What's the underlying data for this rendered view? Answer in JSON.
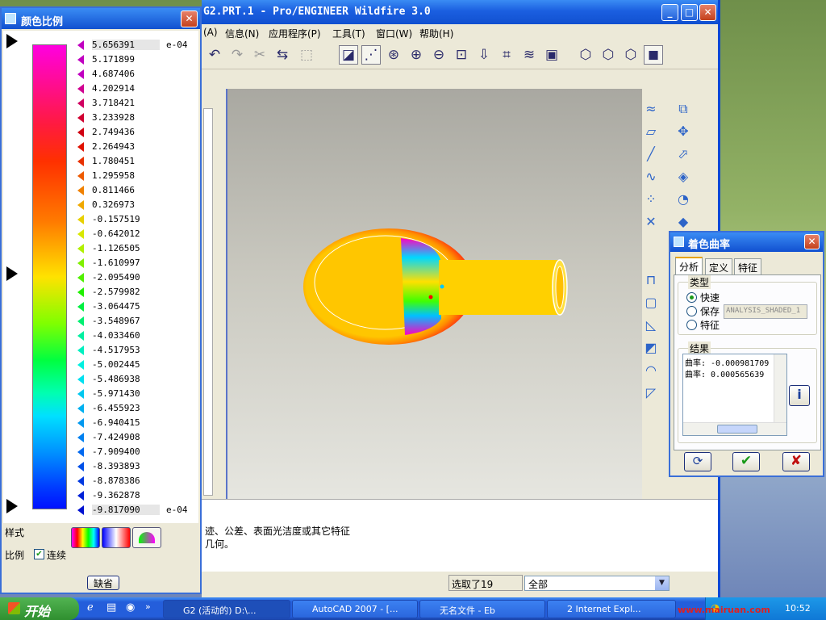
{
  "main_window": {
    "title": "G2.PRT.1 - Pro/ENGINEER Wildfire 3.0",
    "menu": [
      "(A)",
      "信息(N)",
      "应用程序(P)",
      "工具(T)",
      "窗口(W)",
      "帮助(H)"
    ],
    "message_lines": [
      "迹、公差、表面光洁度或其它特征",
      "几何。"
    ],
    "selection_count": "选取了19",
    "filter_value": "全部"
  },
  "scale_panel": {
    "title": "颜色比例",
    "values": [
      "5.656391",
      "5.171899",
      "4.687406",
      "4.202914",
      "3.718421",
      "3.233928",
      "2.749436",
      "2.264943",
      "1.780451",
      "1.295958",
      "0.811466",
      "0.326973",
      "-0.157519",
      "-0.642012",
      "-1.126505",
      "-1.610997",
      "-2.095490",
      "-2.579982",
      "-3.064475",
      "-3.548967",
      "-4.033460",
      "-4.517953",
      "-5.002445",
      "-5.486938",
      "-5.971430",
      "-6.455923",
      "-6.940415",
      "-7.424908",
      "-7.909400",
      "-8.393893",
      "-8.878386",
      "-9.362878",
      "-9.817090"
    ],
    "marker_colors": [
      "#c000c0",
      "#c000c0",
      "#c000c0",
      "#d00090",
      "#d00060",
      "#d00030",
      "#d00010",
      "#e01000",
      "#e83000",
      "#ee5a00",
      "#f08000",
      "#f0a800",
      "#e8d000",
      "#d8e800",
      "#b0f000",
      "#80f000",
      "#50f000",
      "#20f000",
      "#00f040",
      "#00f070",
      "#00f0a0",
      "#00f0c0",
      "#00f0e0",
      "#00e0f0",
      "#00c8f0",
      "#00b0f0",
      "#0098f0",
      "#0080f0",
      "#0068f0",
      "#0050e8",
      "#0038e0",
      "#0020d8",
      "#0010d0"
    ],
    "exponent_top": "e-04",
    "exponent_bottom": "e-04",
    "style_label": "样式",
    "scale_label": "比例",
    "continuous_label": "连续",
    "default_button": "缺省"
  },
  "curvature_dialog": {
    "title": "着色曲率",
    "tabs": [
      "分析",
      "定义",
      "特征"
    ],
    "type_group": "类型",
    "type_options": [
      "快速",
      "保存",
      "特征"
    ],
    "name_value": "ANALYSIS_SHADED_1",
    "result_group": "结果",
    "results": [
      "曲率: -0.000981709",
      "曲率: 0.000565639"
    ]
  },
  "taskbar": {
    "start": "开始",
    "tasks": [
      "G2 (活动的) D:\\...",
      "AutoCAD 2007 - [...",
      "无名文件 - Eb",
      "2 Internet Expl..."
    ],
    "clock": "10:52",
    "watermark": "www.mairuan.com"
  }
}
